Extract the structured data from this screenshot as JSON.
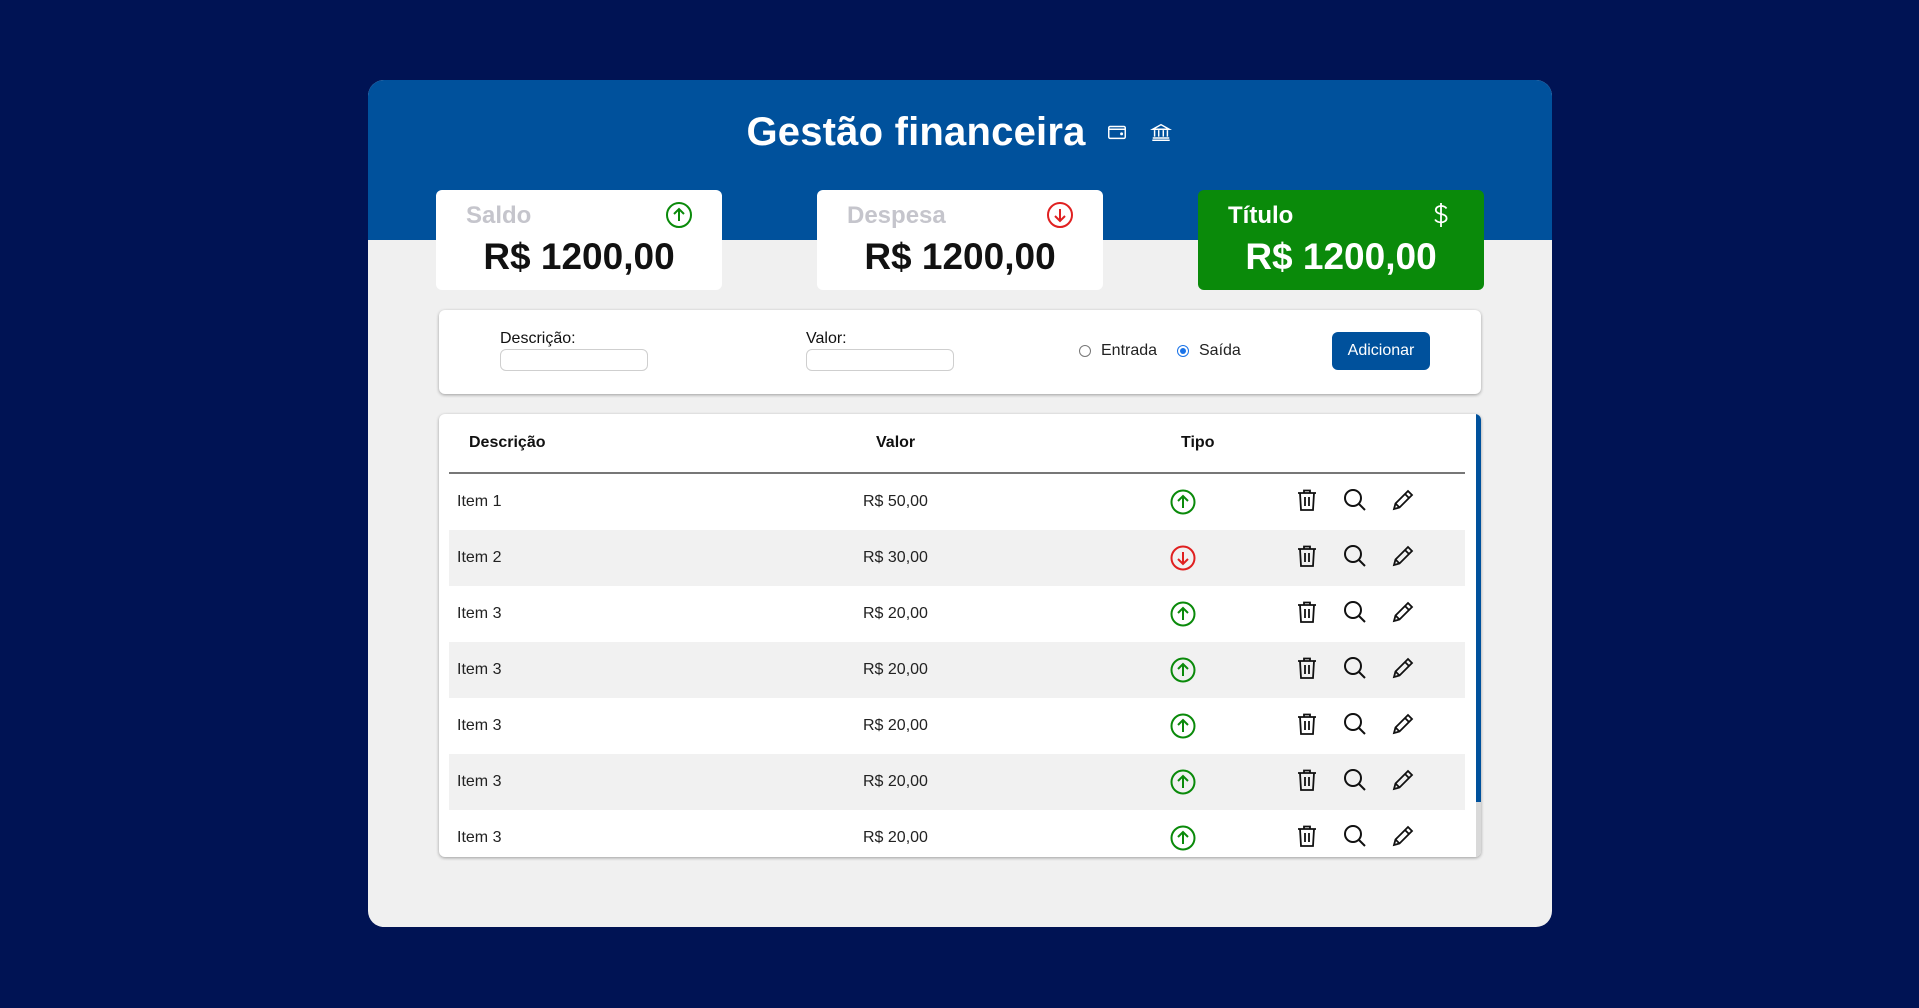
{
  "header": {
    "title": "Gestão financeira",
    "icons": [
      "wallet-icon",
      "bank-icon"
    ]
  },
  "summary": [
    {
      "label": "Saldo",
      "value": "R$ 1200,00",
      "icon": "arrow-up-circle-icon"
    },
    {
      "label": "Despesa",
      "value": "R$ 1200,00",
      "icon": "arrow-down-circle-icon"
    },
    {
      "label": "Título",
      "value": "R$ 1200,00",
      "icon": "dollar-icon"
    }
  ],
  "form": {
    "description_label": "Descrição:",
    "description_value": "",
    "value_label": "Valor:",
    "value_value": "",
    "radio_in_label": "Entrada",
    "radio_out_label": "Saída",
    "selected_type": "Saída",
    "add_label": "Adicionar"
  },
  "table": {
    "headers": {
      "description": "Descrição",
      "value": "Valor",
      "type": "Tipo"
    },
    "rows": [
      {
        "description": "Item 1",
        "value": "R$ 50,00",
        "type": "entrada"
      },
      {
        "description": "Item 2",
        "value": "R$ 30,00",
        "type": "saida"
      },
      {
        "description": "Item 3",
        "value": "R$ 20,00",
        "type": "entrada"
      },
      {
        "description": "Item 3",
        "value": "R$ 20,00",
        "type": "entrada"
      },
      {
        "description": "Item 3",
        "value": "R$ 20,00",
        "type": "entrada"
      },
      {
        "description": "Item 3",
        "value": "R$ 20,00",
        "type": "entrada"
      },
      {
        "description": "Item 3",
        "value": "R$ 20,00",
        "type": "entrada"
      }
    ],
    "row_actions": [
      "trash-icon",
      "search-icon",
      "pencil-icon"
    ]
  },
  "colors": {
    "page_bg": "#001354",
    "brand_blue": "#00519c",
    "income_green": "#0a8a0a",
    "expense_red": "#e02020",
    "panel_bg": "#f0f0f0"
  }
}
